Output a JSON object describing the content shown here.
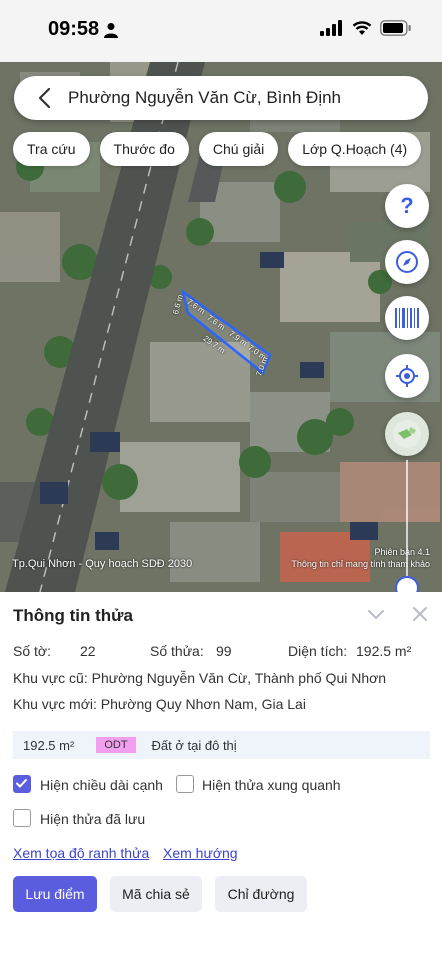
{
  "status_bar": {
    "time": "09:58"
  },
  "search": {
    "text": "Phường Nguyễn Văn Cừ, Bình Định"
  },
  "chips": [
    "Tra cứu",
    "Thước đo",
    "Chú giải",
    "Lớp Q.Hoạch (4)"
  ],
  "map": {
    "plan_label": "Tp.Qui Nhơn - Quy hoạch SDĐ 2030",
    "version": "Phiên bản 4.1",
    "disclaimer": "Thông tin chỉ mang tính tham khảo",
    "parcel_edges": [
      "6.6 m",
      "7.6 m",
      "7.6 m",
      "7.9 m",
      "7.0 m",
      "7.0 m",
      "29.7 m"
    ]
  },
  "map_controls": [
    "help-icon",
    "compass-icon",
    "barcode-icon",
    "locate-icon",
    "layers-icon"
  ],
  "panel": {
    "title": "Thông tin thửa",
    "so_to_label": "Số tờ:",
    "so_to_value": "22",
    "so_thua_label": "Số thửa:",
    "so_thua_value": "99",
    "dien_tich_label": "Diện tích:",
    "dien_tich_value": "192.5 m²",
    "khu_vuc_cu": "Khu vực cũ: Phường Nguyễn Văn Cừ, Thành phố Qui Nhơn",
    "khu_vuc_moi": "Khu vực mới: Phường Quy Nhơn Nam, Gia Lai",
    "area_bar": {
      "area": "192.5 m²",
      "code": "ODT",
      "land_type": "Đất ở tại đô thị",
      "code_color": "#f39ff0"
    },
    "checkboxes": [
      {
        "label": "Hiện chiều dài cạnh",
        "checked": true
      },
      {
        "label": "Hiện thửa xung quanh",
        "checked": false
      },
      {
        "label": "Hiện thửa đã lưu",
        "checked": false
      }
    ],
    "links": [
      "Xem tọa độ ranh thửa",
      "Xem hướng"
    ],
    "buttons": {
      "save": "Lưu điểm",
      "share": "Mã chia sẻ",
      "directions": "Chỉ đường"
    }
  },
  "colors": {
    "accent": "#5b5ddf",
    "link": "#3c44c8"
  }
}
